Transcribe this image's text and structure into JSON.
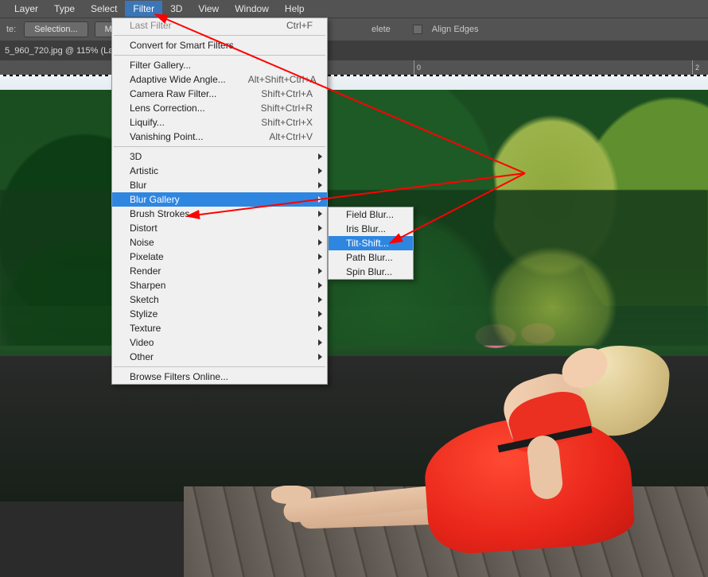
{
  "menubar": {
    "items": [
      {
        "label": "Layer"
      },
      {
        "label": "Type"
      },
      {
        "label": "Select"
      },
      {
        "label": "Filter"
      },
      {
        "label": "3D"
      },
      {
        "label": "View"
      },
      {
        "label": "Window"
      },
      {
        "label": "Help"
      }
    ],
    "active_index": 3
  },
  "toolbar": {
    "label_left": "te:",
    "selection_btn": "Selection...",
    "mask_btn": "Mask",
    "delete_text": "elete",
    "align_edges": "Align Edges"
  },
  "tab": {
    "title": "5_960_720.jpg @ 115% (La"
  },
  "ruler": {
    "ticks": [
      "0",
      "2"
    ]
  },
  "filter_menu": {
    "last_filter": {
      "label": "Last Filter",
      "shortcut": "Ctrl+F"
    },
    "convert_smart": {
      "label": "Convert for Smart Filters"
    },
    "filter_gallery": {
      "label": "Filter Gallery..."
    },
    "adaptive_wide": {
      "label": "Adaptive Wide Angle...",
      "shortcut": "Alt+Shift+Ctrl+A"
    },
    "camera_raw": {
      "label": "Camera Raw Filter...",
      "shortcut": "Shift+Ctrl+A"
    },
    "lens_corr": {
      "label": "Lens Correction...",
      "shortcut": "Shift+Ctrl+R"
    },
    "liquify": {
      "label": "Liquify...",
      "shortcut": "Shift+Ctrl+X"
    },
    "vanishing": {
      "label": "Vanishing Point...",
      "shortcut": "Alt+Ctrl+V"
    },
    "threeD": {
      "label": "3D"
    },
    "artistic": {
      "label": "Artistic"
    },
    "blur": {
      "label": "Blur"
    },
    "blur_gallery": {
      "label": "Blur Gallery"
    },
    "brush_strokes": {
      "label": "Brush Strokes"
    },
    "distort": {
      "label": "Distort"
    },
    "noise": {
      "label": "Noise"
    },
    "pixelate": {
      "label": "Pixelate"
    },
    "render": {
      "label": "Render"
    },
    "sharpen": {
      "label": "Sharpen"
    },
    "sketch": {
      "label": "Sketch"
    },
    "stylize": {
      "label": "Stylize"
    },
    "texture": {
      "label": "Texture"
    },
    "video": {
      "label": "Video"
    },
    "other": {
      "label": "Other"
    },
    "browse": {
      "label": "Browse Filters Online..."
    }
  },
  "blur_gallery_submenu": {
    "field_blur": "Field Blur...",
    "iris_blur": "Iris Blur...",
    "tilt_shift": "Tilt-Shift...",
    "path_blur": "Path Blur...",
    "spin_blur": "Spin Blur..."
  }
}
